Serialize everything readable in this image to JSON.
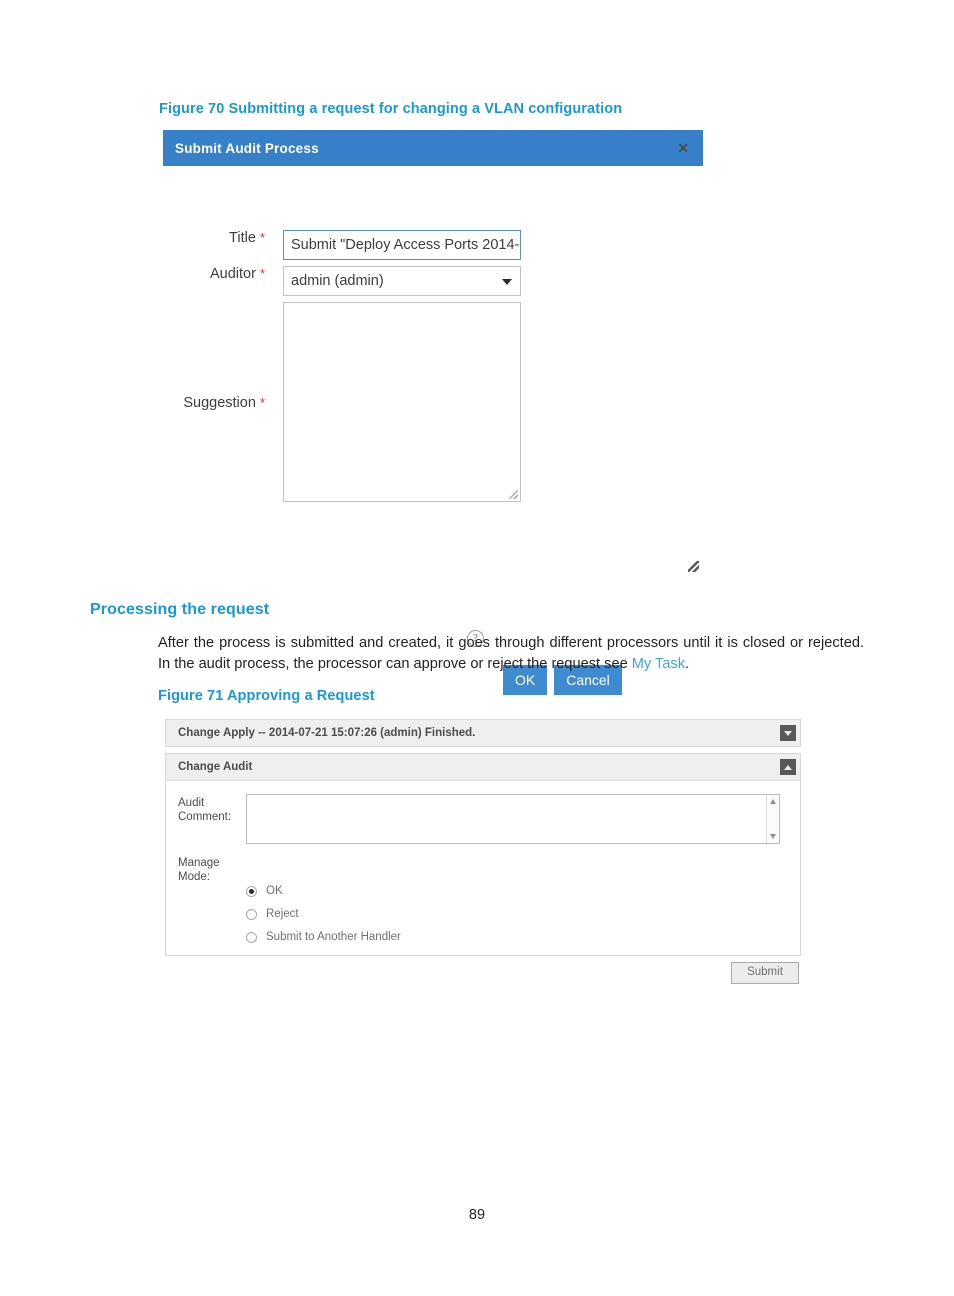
{
  "figure70": {
    "caption": "Figure 70 Submitting a request for changing a VLAN configuration",
    "dialog": {
      "title": "Submit Audit Process",
      "close_icon": "close-icon",
      "fields": {
        "title": {
          "label": "Title",
          "required_marker": "*",
          "value": "Submit \"Deploy Access Ports 2014-"
        },
        "auditor": {
          "label": "Auditor",
          "required_marker": "*",
          "value": "admin (admin)",
          "arrow_icon": "chevron-down-icon"
        },
        "suggestion": {
          "label": "Suggestion",
          "required_marker": "*",
          "value": "",
          "placeholder": ""
        }
      },
      "help_icon_label": "?",
      "buttons": {
        "ok": "OK",
        "cancel": "Cancel"
      }
    }
  },
  "section": {
    "heading": "Processing the request",
    "paragraph_part1": "After the process is submitted and created, it goes through different processors until it is closed or rejected. In the audit process, the processor can approve or reject the request see ",
    "paragraph_link": "My Task",
    "paragraph_part2": "."
  },
  "figure71": {
    "caption": "Figure 71 Approving a Request",
    "panels": [
      {
        "title": "Change Apply -- 2014-07-21 15:07:26 (admin) Finished.",
        "toggle_icon": "chevron-down-icon"
      },
      {
        "title": "Change Audit",
        "toggle_icon": "chevron-up-icon"
      }
    ],
    "audit_form": {
      "comment_label_line1": "Audit",
      "comment_label_line2": "Comment:",
      "comment_value": "",
      "mode_label_line1": "Manage",
      "mode_label_line2": "Mode:",
      "radio_options": [
        {
          "label": "OK",
          "checked": true
        },
        {
          "label": "Reject",
          "checked": false
        },
        {
          "label": "Submit to Another Handler",
          "checked": false
        }
      ],
      "submit_label": "Submit"
    }
  },
  "footer": {
    "page_number": "89"
  },
  "colors": {
    "accent_blue": "#1899d6",
    "dialog_header_blue": "#3580c8",
    "button_blue": "#3e8bd2",
    "link_blue": "#3aa6e0",
    "required_red": "#e03131",
    "panel_gray": "#efefef"
  }
}
